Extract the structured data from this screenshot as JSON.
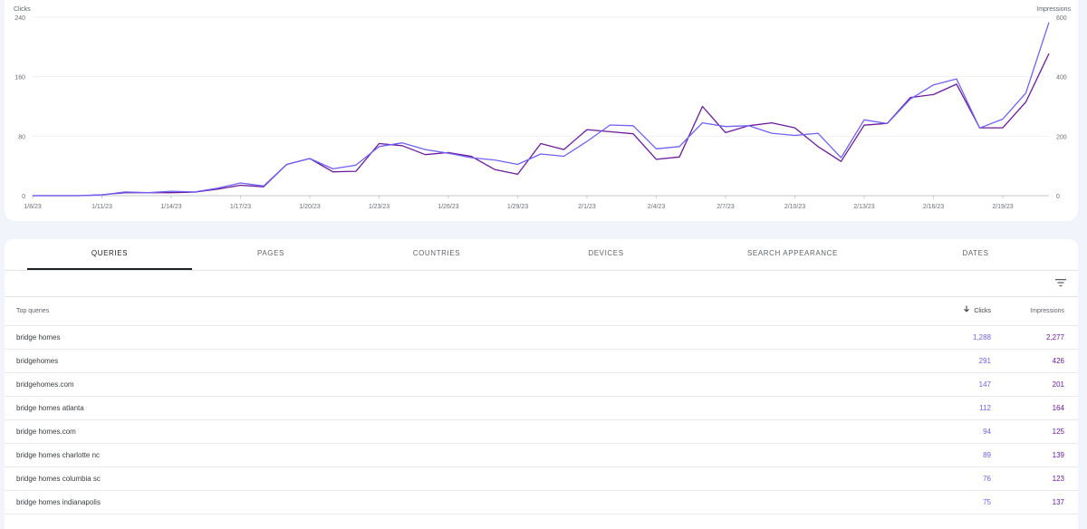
{
  "chart": {
    "left_axis_title": "Clicks",
    "right_axis_title": "Impressions",
    "left_ticks": [
      "0",
      "80",
      "160",
      "240"
    ],
    "right_ticks": [
      "0",
      "200",
      "400",
      "600"
    ],
    "x_labels": [
      "1/8/23",
      "1/11/23",
      "1/14/23",
      "1/17/23",
      "1/20/23",
      "1/23/23",
      "1/26/23",
      "1/29/23",
      "2/1/23",
      "2/4/23",
      "2/7/23",
      "2/10/23",
      "2/13/23",
      "2/16/23",
      "2/19/23"
    ],
    "colors": {
      "clicks": "#6f62f4",
      "impressions": "#6a1b9a",
      "grid": "#eef0f3"
    }
  },
  "chart_data": {
    "type": "line",
    "x": [
      "1/8/23",
      "1/9/23",
      "1/10/23",
      "1/11/23",
      "1/12/23",
      "1/13/23",
      "1/14/23",
      "1/15/23",
      "1/16/23",
      "1/17/23",
      "1/18/23",
      "1/19/23",
      "1/20/23",
      "1/21/23",
      "1/22/23",
      "1/23/23",
      "1/24/23",
      "1/25/23",
      "1/26/23",
      "1/27/23",
      "1/28/23",
      "1/29/23",
      "1/30/23",
      "1/31/23",
      "2/1/23",
      "2/2/23",
      "2/3/23",
      "2/4/23",
      "2/5/23",
      "2/6/23",
      "2/7/23",
      "2/8/23",
      "2/9/23",
      "2/10/23",
      "2/11/23",
      "2/12/23",
      "2/13/23",
      "2/14/23",
      "2/15/23",
      "2/16/23",
      "2/17/23",
      "2/18/23",
      "2/19/23",
      "2/20/23",
      "2/21/23"
    ],
    "series": [
      {
        "name": "Clicks",
        "axis": "left",
        "values": [
          0,
          0,
          0,
          1,
          5,
          4,
          6,
          5,
          10,
          17,
          13,
          42,
          50,
          36,
          41,
          66,
          71,
          62,
          57,
          51,
          48,
          42,
          56,
          53,
          73,
          95,
          94,
          63,
          66,
          98,
          93,
          94,
          84,
          81,
          84,
          51,
          102,
          97,
          130,
          149,
          157,
          91,
          103,
          138,
          233
        ]
      },
      {
        "name": "Impressions",
        "axis": "right",
        "values": [
          0,
          0,
          0,
          3,
          10,
          10,
          10,
          12,
          22,
          35,
          30,
          105,
          125,
          80,
          82,
          175,
          168,
          138,
          145,
          132,
          88,
          72,
          175,
          155,
          222,
          215,
          208,
          122,
          130,
          300,
          212,
          235,
          245,
          228,
          165,
          115,
          237,
          243,
          330,
          340,
          375,
          228,
          228,
          315,
          478
        ]
      }
    ],
    "left_axis": {
      "label": "Clicks",
      "range": [
        0,
        240
      ]
    },
    "right_axis": {
      "label": "Impressions",
      "range": [
        0,
        600
      ]
    },
    "grid": true
  },
  "tabs": [
    {
      "label": "QUERIES",
      "active": true
    },
    {
      "label": "PAGES"
    },
    {
      "label": "COUNTRIES"
    },
    {
      "label": "DEVICES"
    },
    {
      "label": "SEARCH APPEARANCE"
    },
    {
      "label": "DATES"
    }
  ],
  "table": {
    "columns": {
      "query": "Top queries",
      "clicks": "Clicks",
      "impressions": "Impressions"
    },
    "rows": [
      {
        "query": "bridge homes",
        "clicks": "1,288",
        "impressions": "2,277"
      },
      {
        "query": "bridgehomes",
        "clicks": "291",
        "impressions": "426"
      },
      {
        "query": "bridgehomes.com",
        "clicks": "147",
        "impressions": "201"
      },
      {
        "query": "bridge homes atlanta",
        "clicks": "112",
        "impressions": "164"
      },
      {
        "query": "bridge homes.com",
        "clicks": "94",
        "impressions": "125"
      },
      {
        "query": "bridge homes charlotte nc",
        "clicks": "89",
        "impressions": "139"
      },
      {
        "query": "bridge homes columbia sc",
        "clicks": "76",
        "impressions": "123"
      },
      {
        "query": "bridge homes indianapolis",
        "clicks": "75",
        "impressions": "137"
      }
    ]
  },
  "icons": {
    "filter": "filter-icon",
    "sort": "arrow-down-icon"
  }
}
